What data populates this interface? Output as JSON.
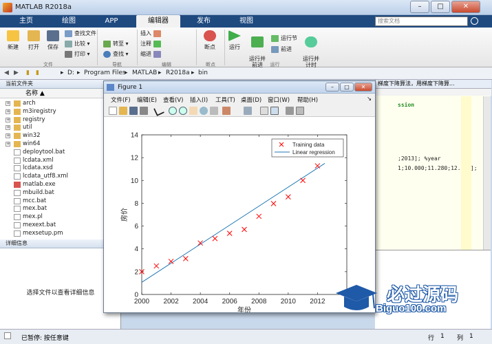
{
  "window": {
    "title": "MATLAB R2018a",
    "min": "–",
    "max": "□",
    "close": "✕"
  },
  "tabs": [
    {
      "label": "主页"
    },
    {
      "label": "绘图"
    },
    {
      "label": "APP"
    },
    {
      "label": "编辑器"
    },
    {
      "label": "发布"
    },
    {
      "label": "视图"
    }
  ],
  "search": {
    "placeholder": "搜索文档"
  },
  "ribbon": {
    "new": "新建",
    "open": "打开",
    "save": "保存",
    "find_files": "查找文件",
    "compare": "比较",
    "print": "打印",
    "goto": "转至",
    "find": "查找",
    "insert": "插入",
    "comment": "注释",
    "indent": "缩进",
    "breakpoints": "断点",
    "run": "运行",
    "run_advance": "运行并\n前进",
    "run_section": "运行节",
    "advance": "前进",
    "run_time": "运行并\n计时",
    "group_file": "文件",
    "group_nav": "导航",
    "group_edit": "编辑",
    "group_bp": "断点",
    "group_run": "运行"
  },
  "address": {
    "path": [
      "D:",
      "Program Files",
      "MATLAB",
      "R2018a",
      "bin"
    ]
  },
  "current_folder": {
    "header": "当前文件夹",
    "col_name": "名称 ▲",
    "files": [
      {
        "name": "arch",
        "type": "folder"
      },
      {
        "name": "m3iregistry",
        "type": "folder"
      },
      {
        "name": "registry",
        "type": "folder"
      },
      {
        "name": "util",
        "type": "folder"
      },
      {
        "name": "win32",
        "type": "folder"
      },
      {
        "name": "win64",
        "type": "folder"
      },
      {
        "name": "deploytool.bat",
        "type": "bat"
      },
      {
        "name": "lcdata.xml",
        "type": "xml"
      },
      {
        "name": "lcdata.xsd",
        "type": "xml"
      },
      {
        "name": "lcdata_utf8.xml",
        "type": "xml"
      },
      {
        "name": "matlab.exe",
        "type": "exe"
      },
      {
        "name": "mbuild.bat",
        "type": "bat"
      },
      {
        "name": "mcc.bat",
        "type": "bat"
      },
      {
        "name": "mex.bat",
        "type": "bat"
      },
      {
        "name": "mex.pl",
        "type": "pl"
      },
      {
        "name": "mexext.bat",
        "type": "bat"
      },
      {
        "name": "mexsetup.pm",
        "type": "pl"
      }
    ]
  },
  "details": {
    "header": "详细信息",
    "empty_text": "选择文件以查看详细信息"
  },
  "editor": {
    "tab_title": "梯度下降算法，用梯度下降算...",
    "lines": [
      "ssion",
      "",
      "",
      "",
      ";2013];  %year",
      "1;10.000;11.280;12.900];"
    ]
  },
  "status": {
    "text": "已暂停: 按任意键",
    "row_label": "行",
    "row": "1",
    "col_label": "列",
    "col": "1"
  },
  "figure": {
    "title": "Figure 1",
    "menu": [
      "文件(F)",
      "编辑(E)",
      "查看(V)",
      "插入(I)",
      "工具(T)",
      "桌面(D)",
      "窗口(W)",
      "帮助(H)"
    ]
  },
  "chart_data": {
    "type": "scatter",
    "title": "",
    "xlabel": "年份",
    "ylabel": "房价",
    "xlim": [
      2000,
      2014
    ],
    "ylim": [
      0,
      14
    ],
    "xticks": [
      2000,
      2002,
      2004,
      2006,
      2008,
      2010,
      2012
    ],
    "yticks": [
      0,
      2,
      4,
      6,
      8,
      10,
      12,
      14
    ],
    "legend_position": "top-right",
    "series": [
      {
        "name": "Training data",
        "marker": "x",
        "color": "#ff0000",
        "x": [
          2000,
          2001,
          2002,
          2003,
          2004,
          2005,
          2006,
          2007,
          2008,
          2009,
          2010,
          2011,
          2012
        ],
        "y": [
          2.0,
          2.5,
          2.9,
          3.147,
          4.515,
          4.903,
          5.365,
          5.704,
          6.853,
          7.971,
          8.561,
          10.0,
          11.28
        ]
      },
      {
        "name": "Linear regression",
        "type": "line",
        "color": "#1f77b4",
        "x": [
          2000,
          2012.5
        ],
        "y": [
          1.07,
          11.5
        ]
      }
    ]
  },
  "watermark": {
    "cn": "必过源码",
    "en": "Biguo100.com"
  }
}
